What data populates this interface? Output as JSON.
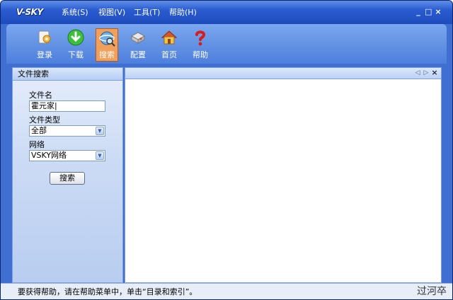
{
  "app": {
    "logo_text": "V-SKY"
  },
  "menu": [
    {
      "label": "系统(S)"
    },
    {
      "label": "视图(V)"
    },
    {
      "label": "工具(T)"
    },
    {
      "label": "帮助(H)"
    }
  ],
  "window_controls": {
    "minimize": "_",
    "maximize": "□",
    "close": "×"
  },
  "toolbar": {
    "items": [
      {
        "label": "登录",
        "icon": "key-icon"
      },
      {
        "label": "下载",
        "icon": "download-arrow-icon"
      },
      {
        "label": "搜索",
        "icon": "globe-magnifier-icon",
        "active": true
      },
      {
        "label": "配置",
        "icon": "drive-config-icon"
      },
      {
        "label": "首页",
        "icon": "home-icon"
      },
      {
        "label": "帮助",
        "icon": "question-icon"
      }
    ]
  },
  "search_panel": {
    "title": "文件搜索",
    "filename_label": "文件名",
    "filename_value": "霍元家|",
    "filetype_label": "文件类型",
    "filetype_value": "全部",
    "network_label": "网络",
    "network_value": "VSKY网络",
    "search_button": "搜索"
  },
  "result_panel": {
    "prev": "◁",
    "next": "▷",
    "close": "×"
  },
  "status": {
    "text": "要获得帮助，请在帮助菜单中，单击“目录和索引”。"
  },
  "watermark": "过河卒",
  "colors": {
    "titlebar": "#2a5bd0",
    "toolbar": "#5f8ee3",
    "active_tool": "#f0a05a"
  }
}
